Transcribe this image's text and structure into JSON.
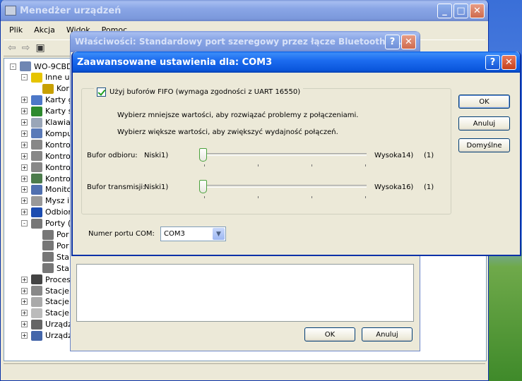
{
  "device_manager": {
    "title": "Menedżer urządzeń",
    "menu": [
      "Plik",
      "Akcja",
      "Widok",
      "Pomoc"
    ],
    "tree": [
      {
        "label": "WO-9CBDD",
        "expander": "-"
      },
      {
        "label": "Inne u",
        "expander": "-"
      },
      {
        "label": "Kor",
        "expander": ""
      },
      {
        "label": "Karty g",
        "expander": "+"
      },
      {
        "label": "Karty s",
        "expander": "+"
      },
      {
        "label": "Klawiat",
        "expander": "+"
      },
      {
        "label": "Kompu",
        "expander": "+"
      },
      {
        "label": "Kontro",
        "expander": "+"
      },
      {
        "label": "Kontro",
        "expander": "+"
      },
      {
        "label": "Kontro",
        "expander": "+"
      },
      {
        "label": "Kontro",
        "expander": "+"
      },
      {
        "label": "Monito",
        "expander": "+"
      },
      {
        "label": "Mysz i",
        "expander": "+"
      },
      {
        "label": "Odbior",
        "expander": "+"
      },
      {
        "label": "Porty (",
        "expander": "-"
      },
      {
        "label": "Por",
        "expander": ""
      },
      {
        "label": "Por",
        "expander": ""
      },
      {
        "label": "Sta",
        "expander": ""
      },
      {
        "label": "Sta",
        "expander": ""
      },
      {
        "label": "Proces",
        "expander": "+"
      },
      {
        "label": "Stacje",
        "expander": "+"
      },
      {
        "label": "Stacje",
        "expander": "+"
      },
      {
        "label": "Stacje",
        "expander": "+"
      },
      {
        "label": "Urządz",
        "expander": "+"
      },
      {
        "label": "Urządz",
        "expander": "+"
      }
    ]
  },
  "properties": {
    "title": "Właściwości: Standardowy port szeregowy przez łącze Bluetooth (C...",
    "ok": "OK",
    "cancel": "Anuluj"
  },
  "advanced": {
    "title": "Zaawansowane ustawienia dla: COM3",
    "fifo_label": "Użyj buforów FIFO (wymaga zgodności z UART 16550)",
    "fifo_checked": true,
    "hint1": "Wybierz mniejsze wartości, aby rozwiązać problemy z połączeniami.",
    "hint2": "Wybierz większe wartości, aby zwiększyć wydajność połączeń.",
    "rx": {
      "label": "Bufor odbioru:",
      "low": "Niski1)",
      "high": "Wysoka14)",
      "value": "(1)",
      "level": 0
    },
    "tx": {
      "label": "Bufor transmisji:",
      "low": "Niski1)",
      "high": "Wysoka16)",
      "value": "(1)",
      "level": 0
    },
    "com_label": "Numer portu COM:",
    "com_value": "COM3",
    "buttons": {
      "ok": "OK",
      "cancel": "Anuluj",
      "defaults": "Domyślne"
    }
  }
}
